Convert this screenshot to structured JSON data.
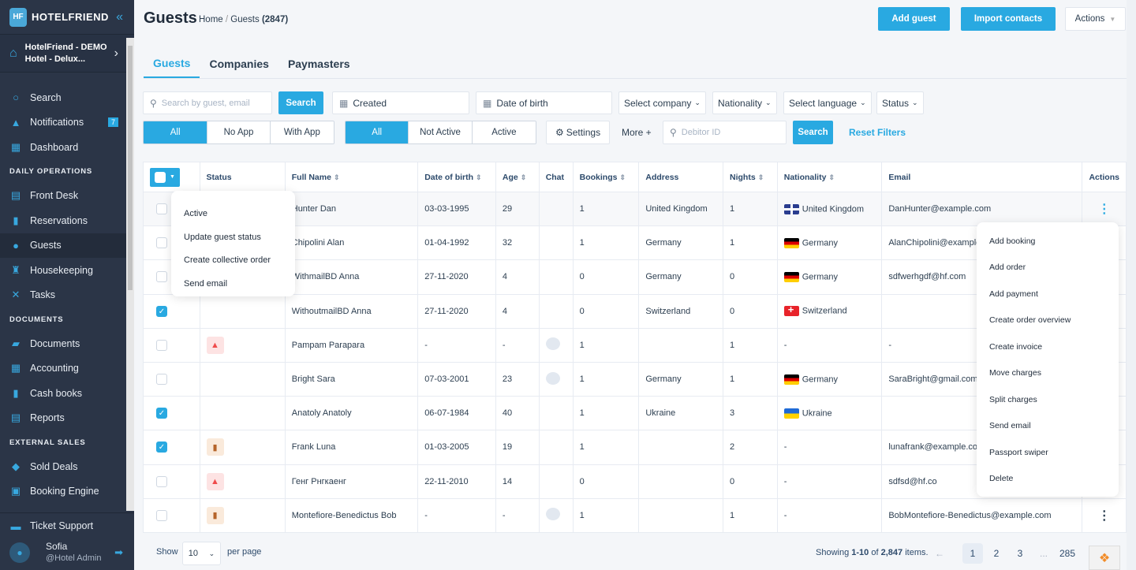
{
  "sidebar": {
    "brand": "HOTELFRIEND",
    "logo_mark": "HF",
    "hotel_name_line1": "HotelFriend - DEMO",
    "hotel_name_line2": "Hotel - Delux...",
    "items": [
      {
        "label": "Search",
        "icon": "search-icon"
      },
      {
        "label": "Notifications",
        "icon": "bell-icon",
        "badge": "7"
      },
      {
        "label": "Dashboard",
        "icon": "dashboard-icon"
      }
    ],
    "sections": [
      {
        "title": "DAILY OPERATIONS",
        "items": [
          {
            "label": "Front Desk",
            "icon": "calendar-icon"
          },
          {
            "label": "Reservations",
            "icon": "document-icon"
          },
          {
            "label": "Guests",
            "icon": "user-icon",
            "active": true
          },
          {
            "label": "Housekeeping",
            "icon": "broom-icon"
          },
          {
            "label": "Tasks",
            "icon": "wrench-icon"
          }
        ]
      },
      {
        "title": "DOCUMENTS",
        "items": [
          {
            "label": "Documents",
            "icon": "folder-icon"
          },
          {
            "label": "Accounting",
            "icon": "grid-icon"
          },
          {
            "label": "Cash books",
            "icon": "book-icon"
          },
          {
            "label": "Reports",
            "icon": "clipboard-icon"
          }
        ]
      },
      {
        "title": "EXTERNAL SALES",
        "items": [
          {
            "label": "Sold Deals",
            "icon": "tag-icon"
          },
          {
            "label": "Booking Engine",
            "icon": "browser-gear-icon"
          }
        ]
      }
    ],
    "ticket_support": "Ticket Support",
    "user_name": "Sofia",
    "user_role": "@Hotel Admin"
  },
  "header": {
    "title": "Guests",
    "breadcrumb_home": "Home",
    "breadcrumb_sep": "/",
    "breadcrumb_current": "Guests",
    "breadcrumb_count": "(2847)",
    "add_guest": "Add guest",
    "import_contacts": "Import contacts",
    "actions": "Actions"
  },
  "tabs": [
    "Guests",
    "Companies",
    "Paymasters"
  ],
  "filters": {
    "search_placeholder": "Search by guest, email",
    "search_button": "Search",
    "created": "Created",
    "date_of_birth": "Date of birth",
    "select_company": "Select company",
    "nationality": "Nationality",
    "select_language": "Select language",
    "status": "Status",
    "app_segment": [
      "All",
      "No App",
      "With App"
    ],
    "active_segment": [
      "All",
      "Not Active",
      "Active"
    ],
    "settings": "Settings",
    "more": "More +",
    "debitor_placeholder": "Debitor ID",
    "search_button2": "Search",
    "reset": "Reset Filters"
  },
  "table": {
    "headers": [
      "Status",
      "Full Name",
      "Date of birth",
      "Age",
      "Chat",
      "Bookings",
      "Address",
      "Nights",
      "Nationality",
      "Email",
      "Actions"
    ],
    "rows": [
      {
        "checked": false,
        "status": "",
        "name": "Hunter Dan",
        "dob": "03-03-1995",
        "age": "29",
        "chat": false,
        "bookings": "1",
        "address": "United Kingdom",
        "nights": "1",
        "flag": "gb",
        "nationality": "United Kingdom",
        "email": "DanHunter@example.com"
      },
      {
        "checked": false,
        "status": "",
        "name": "Chipolini Alan",
        "dob": "01-04-1992",
        "age": "32",
        "chat": false,
        "bookings": "1",
        "address": "Germany",
        "nights": "1",
        "flag": "de",
        "nationality": "Germany",
        "email": "AlanChipolini@example.com"
      },
      {
        "checked": false,
        "status": "",
        "name": "WithmailBD Anna",
        "dob": "27-11-2020",
        "age": "4",
        "chat": false,
        "bookings": "0",
        "address": "Germany",
        "nights": "0",
        "flag": "de",
        "nationality": "Germany",
        "email": "sdfwerhgdf@hf.com"
      },
      {
        "checked": true,
        "status": "",
        "name": "WithoutmailBD Anna",
        "dob": "27-11-2020",
        "age": "4",
        "chat": false,
        "bookings": "0",
        "address": "Switzerland",
        "nights": "0",
        "flag": "ch",
        "nationality": "Switzerland",
        "email": ""
      },
      {
        "checked": false,
        "status": "red",
        "name": "Pampam Parapara",
        "dob": "-",
        "age": "-",
        "chat": true,
        "bookings": "1",
        "address": "",
        "nights": "1",
        "flag": "",
        "nationality": "-",
        "email": "-"
      },
      {
        "checked": false,
        "status": "",
        "name": "Bright Sara",
        "dob": "07-03-2001",
        "age": "23",
        "chat": true,
        "bookings": "1",
        "address": "Germany",
        "nights": "1",
        "flag": "de",
        "nationality": "Germany",
        "email": "SaraBright@gmail.com"
      },
      {
        "checked": true,
        "status": "",
        "name": "Anatoly Anatoly",
        "dob": "06-07-1984",
        "age": "40",
        "chat": false,
        "bookings": "1",
        "address": "Ukraine",
        "nights": "3",
        "flag": "ua",
        "nationality": "Ukraine",
        "email": ""
      },
      {
        "checked": true,
        "status": "brown",
        "name": "Frank Luna",
        "dob": "01-03-2005",
        "age": "19",
        "chat": false,
        "bookings": "1",
        "address": "",
        "nights": "2",
        "flag": "",
        "nationality": "-",
        "email": "lunafrank@example.com"
      },
      {
        "checked": false,
        "status": "red",
        "name": "Генг Рнгкаенг",
        "dob": "22-11-2010",
        "age": "14",
        "chat": false,
        "bookings": "0",
        "address": "",
        "nights": "0",
        "flag": "",
        "nationality": "-",
        "email": "sdfsd@hf.co"
      },
      {
        "checked": false,
        "status": "brown",
        "name": "Montefiore-Benedictus Bob",
        "dob": "-",
        "age": "-",
        "chat": true,
        "bookings": "1",
        "address": "",
        "nights": "1",
        "flag": "",
        "nationality": "-",
        "email": "BobMontefiore-Benedictus@example.com"
      }
    ]
  },
  "bulk_menu": [
    "Active",
    "Update guest status",
    "Create collective order",
    "Send email"
  ],
  "row_menu": [
    "Add booking",
    "Add order",
    "Add payment",
    "Create order overview",
    "Create invoice",
    "Move charges",
    "Split charges",
    "Send email",
    "Passport swiper",
    "Delete"
  ],
  "footer": {
    "show": "Show",
    "per_page_value": "10",
    "per_page": "per page",
    "showing_prefix": "Showing",
    "showing_range": "1-10",
    "showing_of": "of",
    "showing_total": "2,847",
    "showing_suffix": "items.",
    "pages": [
      "1",
      "2",
      "3",
      "...",
      "285"
    ],
    "current_page": "1"
  },
  "colors": {
    "accent": "#29a9e1",
    "sidebar": "#2b3547"
  }
}
